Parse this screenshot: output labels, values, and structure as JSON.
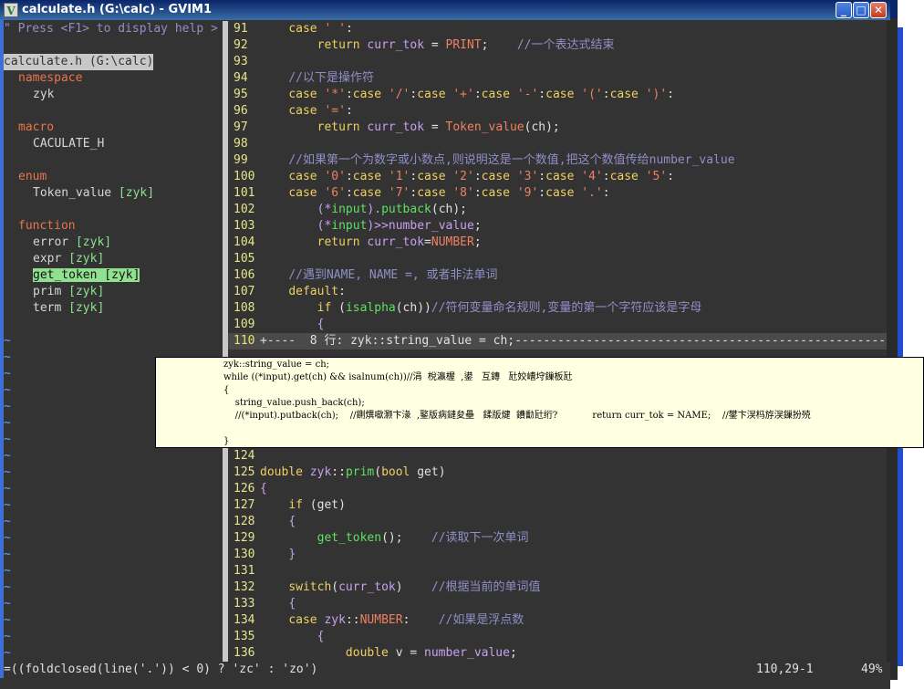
{
  "window": {
    "title": "calculate.h (G:\\calc) - GVIM1",
    "icon_letter": "V",
    "buttons": {
      "minimize": "_",
      "maximize": "□",
      "close": "✕"
    }
  },
  "taglist": {
    "help_hint": "\" Press <F1> to display help >",
    "file": "calculate.h (G:\\calc)",
    "groups": [
      {
        "kind": "namespace",
        "items": [
          {
            "name": "zyk",
            "scope": ""
          }
        ]
      },
      {
        "kind": "macro",
        "items": [
          {
            "name": "CACULATE_H",
            "scope": ""
          }
        ]
      },
      {
        "kind": "enum",
        "items": [
          {
            "name": "Token_value",
            "scope": "[zyk]"
          }
        ]
      },
      {
        "kind": "function",
        "items": [
          {
            "name": "error",
            "scope": "[zyk]"
          },
          {
            "name": "expr",
            "scope": "[zyk]"
          },
          {
            "name": "get_token",
            "scope": "[zyk]",
            "selected": true
          },
          {
            "name": "prim",
            "scope": "[zyk]"
          },
          {
            "name": "term",
            "scope": "[zyk]"
          }
        ]
      }
    ],
    "tilde": "~"
  },
  "code_lines": [
    {
      "n": "91",
      "segs": [
        [
          "tx",
          "    "
        ],
        [
          "kw",
          "case"
        ],
        [
          "tx",
          " "
        ],
        [
          "str",
          "' '"
        ],
        [
          "tx",
          ":"
        ]
      ]
    },
    {
      "n": "92",
      "segs": [
        [
          "tx",
          "        "
        ],
        [
          "kw",
          "return"
        ],
        [
          "tx",
          " "
        ],
        [
          "id",
          "curr_tok"
        ],
        [
          "tx",
          " = "
        ],
        [
          "str",
          "PRINT"
        ],
        [
          "tx",
          ";    "
        ],
        [
          "cm",
          "//一个表达式结束"
        ]
      ]
    },
    {
      "n": "93",
      "segs": []
    },
    {
      "n": "94",
      "segs": [
        [
          "tx",
          "    "
        ],
        [
          "cm",
          "//以下是操作符"
        ]
      ]
    },
    {
      "n": "95",
      "segs": [
        [
          "tx",
          "    "
        ],
        [
          "kw",
          "case"
        ],
        [
          "tx",
          " "
        ],
        [
          "str",
          "'*'"
        ],
        [
          "tx",
          ":"
        ],
        [
          "kw",
          "case"
        ],
        [
          "tx",
          " "
        ],
        [
          "str",
          "'/'"
        ],
        [
          "tx",
          ":"
        ],
        [
          "kw",
          "case"
        ],
        [
          "tx",
          " "
        ],
        [
          "str",
          "'+'"
        ],
        [
          "tx",
          ":"
        ],
        [
          "kw",
          "case"
        ],
        [
          "tx",
          " "
        ],
        [
          "str",
          "'-'"
        ],
        [
          "tx",
          ":"
        ],
        [
          "kw",
          "case"
        ],
        [
          "tx",
          " "
        ],
        [
          "str",
          "'('"
        ],
        [
          "tx",
          ":"
        ],
        [
          "kw",
          "case"
        ],
        [
          "tx",
          " "
        ],
        [
          "str",
          "')'"
        ],
        [
          "tx",
          ":"
        ]
      ]
    },
    {
      "n": "96",
      "segs": [
        [
          "tx",
          "    "
        ],
        [
          "kw",
          "case"
        ],
        [
          "tx",
          " "
        ],
        [
          "str",
          "'='"
        ],
        [
          "tx",
          ":"
        ]
      ]
    },
    {
      "n": "97",
      "segs": [
        [
          "tx",
          "        "
        ],
        [
          "kw",
          "return"
        ],
        [
          "tx",
          " "
        ],
        [
          "id",
          "curr_tok"
        ],
        [
          "tx",
          " = "
        ],
        [
          "str",
          "Token_value"
        ],
        [
          "tx",
          "(ch);"
        ]
      ]
    },
    {
      "n": "98",
      "segs": []
    },
    {
      "n": "99",
      "segs": [
        [
          "tx",
          "    "
        ],
        [
          "cm",
          "//如果第一个为数字或小数点,则说明这是一个数值,把这个数值传给number_value"
        ]
      ]
    },
    {
      "n": "100",
      "segs": [
        [
          "tx",
          "    "
        ],
        [
          "kw",
          "case"
        ],
        [
          "tx",
          " "
        ],
        [
          "str",
          "'0'"
        ],
        [
          "tx",
          ":"
        ],
        [
          "kw",
          "case"
        ],
        [
          "tx",
          " "
        ],
        [
          "str",
          "'1'"
        ],
        [
          "tx",
          ":"
        ],
        [
          "kw",
          "case"
        ],
        [
          "tx",
          " "
        ],
        [
          "str",
          "'2'"
        ],
        [
          "tx",
          ":"
        ],
        [
          "kw",
          "case"
        ],
        [
          "tx",
          " "
        ],
        [
          "str",
          "'3'"
        ],
        [
          "tx",
          ":"
        ],
        [
          "kw",
          "case"
        ],
        [
          "tx",
          " "
        ],
        [
          "str",
          "'4'"
        ],
        [
          "tx",
          ":"
        ],
        [
          "kw",
          "case"
        ],
        [
          "tx",
          " "
        ],
        [
          "str",
          "'5'"
        ],
        [
          "tx",
          ":"
        ]
      ]
    },
    {
      "n": "101",
      "segs": [
        [
          "tx",
          "    "
        ],
        [
          "kw",
          "case"
        ],
        [
          "tx",
          " "
        ],
        [
          "str",
          "'6'"
        ],
        [
          "tx",
          ":"
        ],
        [
          "kw",
          "case"
        ],
        [
          "tx",
          " "
        ],
        [
          "str",
          "'7'"
        ],
        [
          "tx",
          ":"
        ],
        [
          "kw",
          "case"
        ],
        [
          "tx",
          " "
        ],
        [
          "str",
          "'8'"
        ],
        [
          "tx",
          ":"
        ],
        [
          "kw",
          "case"
        ],
        [
          "tx",
          " "
        ],
        [
          "str",
          "'9'"
        ],
        [
          "tx",
          ":"
        ],
        [
          "kw",
          "case"
        ],
        [
          "tx",
          " "
        ],
        [
          "str",
          "'.'"
        ],
        [
          "tx",
          ":"
        ]
      ]
    },
    {
      "n": "102",
      "segs": [
        [
          "tx",
          "        "
        ],
        [
          "id",
          "(*"
        ],
        [
          "fn",
          "input"
        ],
        [
          "id",
          ")."
        ],
        [
          "fn",
          "putback"
        ],
        [
          "tx",
          "(ch);"
        ]
      ]
    },
    {
      "n": "103",
      "segs": [
        [
          "tx",
          "        "
        ],
        [
          "id",
          "(*"
        ],
        [
          "fn",
          "input"
        ],
        [
          "id",
          ")>>"
        ],
        [
          "id",
          "number_value"
        ],
        [
          "tx",
          ";"
        ]
      ]
    },
    {
      "n": "104",
      "segs": [
        [
          "tx",
          "        "
        ],
        [
          "kw",
          "return"
        ],
        [
          "tx",
          " "
        ],
        [
          "id",
          "curr_tok"
        ],
        [
          "tx",
          "="
        ],
        [
          "str",
          "NUMBER"
        ],
        [
          "tx",
          ";"
        ]
      ]
    },
    {
      "n": "105",
      "segs": []
    },
    {
      "n": "106",
      "segs": [
        [
          "tx",
          "    "
        ],
        [
          "cm",
          "//遇到NAME, NAME =, 或者非法单词"
        ]
      ]
    },
    {
      "n": "107",
      "segs": [
        [
          "tx",
          "    "
        ],
        [
          "kw",
          "default"
        ],
        [
          "tx",
          ":"
        ]
      ]
    },
    {
      "n": "108",
      "segs": [
        [
          "tx",
          "        "
        ],
        [
          "kw",
          "if"
        ],
        [
          "tx",
          " ("
        ],
        [
          "fn",
          "isalpha"
        ],
        [
          "tx",
          "(ch))"
        ],
        [
          "cm",
          "//符何变量命名规则,变量的第一个字符应该是字母"
        ]
      ]
    },
    {
      "n": "109",
      "segs": [
        [
          "tx",
          "        "
        ],
        [
          "id",
          "{"
        ]
      ]
    },
    {
      "n": "110",
      "fold": true,
      "segs": [
        [
          "tx",
          "+----  8 行: zyk::string_value = ch;-----------------------------------------------------"
        ]
      ]
    },
    {
      "n": "",
      "segs": [],
      "hidden": true
    },
    {
      "n": "",
      "segs": [],
      "hidden": true
    },
    {
      "n": "",
      "segs": [],
      "hidden": true
    },
    {
      "n": "",
      "segs": [],
      "hidden": true
    },
    {
      "n": "",
      "segs": [],
      "hidden": true
    },
    {
      "n": "",
      "segs": [],
      "hidden": true
    },
    {
      "n": "124",
      "segs": []
    },
    {
      "n": "125",
      "segs": [
        [
          "ty",
          "double"
        ],
        [
          "tx",
          " "
        ],
        [
          "id",
          "zyk"
        ],
        [
          "tx",
          "::"
        ],
        [
          "fn",
          "prim"
        ],
        [
          "tx",
          "("
        ],
        [
          "ty",
          "bool"
        ],
        [
          "tx",
          " get)"
        ]
      ]
    },
    {
      "n": "126",
      "segs": [
        [
          "id",
          "{"
        ]
      ]
    },
    {
      "n": "127",
      "segs": [
        [
          "tx",
          "    "
        ],
        [
          "kw",
          "if"
        ],
        [
          "tx",
          " (get)"
        ]
      ]
    },
    {
      "n": "128",
      "segs": [
        [
          "tx",
          "    "
        ],
        [
          "id",
          "{"
        ]
      ]
    },
    {
      "n": "129",
      "segs": [
        [
          "tx",
          "        "
        ],
        [
          "fn",
          "get_token"
        ],
        [
          "tx",
          "();    "
        ],
        [
          "cm",
          "//读取下一次单词"
        ]
      ]
    },
    {
      "n": "130",
      "segs": [
        [
          "tx",
          "    "
        ],
        [
          "id",
          "}"
        ]
      ]
    },
    {
      "n": "131",
      "segs": []
    },
    {
      "n": "132",
      "segs": [
        [
          "tx",
          "    "
        ],
        [
          "kw",
          "switch"
        ],
        [
          "tx",
          "("
        ],
        [
          "id",
          "curr_tok"
        ],
        [
          "tx",
          ")    "
        ],
        [
          "cm",
          "//根据当前的单词值"
        ]
      ]
    },
    {
      "n": "133",
      "segs": [
        [
          "tx",
          "    "
        ],
        [
          "id",
          "{"
        ]
      ]
    },
    {
      "n": "134",
      "segs": [
        [
          "tx",
          "    "
        ],
        [
          "kw",
          "case"
        ],
        [
          "tx",
          " "
        ],
        [
          "id",
          "zyk"
        ],
        [
          "tx",
          "::"
        ],
        [
          "str",
          "NUMBER"
        ],
        [
          "tx",
          ":    "
        ],
        [
          "cm",
          "//如果是浮点数"
        ]
      ]
    },
    {
      "n": "135",
      "segs": [
        [
          "tx",
          "        "
        ],
        [
          "id",
          "{"
        ]
      ]
    },
    {
      "n": "136",
      "segs": [
        [
          "tx",
          "            "
        ],
        [
          "ty",
          "double"
        ],
        [
          "tx",
          " v = "
        ],
        [
          "id",
          "number_value"
        ],
        [
          "tx",
          ";"
        ]
      ]
    }
  ],
  "balloon": {
    "lines": [
      "zyk::string_value = ch;",
      "while ((*input).get(ch) && isalnum(ch))//涓  梲瀛楃  ,鍙   互鏄   瓧姣嶆垨鏁板瓧",
      "{",
      "    string_value.push_back(ch);",
      "    //(*input).putback(ch);    //鍘熼噷灏卞湪  ,鐜版病鏈夋壘   鍒版煡  鐨勫瓧绗?            return curr_tok = NAME;    //鐢卞洖杩斿洖鏁扮殑",
      "",
      "}"
    ]
  },
  "cmdline": {
    "text": "=((foldclosed(line('.')) < 0) ? 'zc' : 'zo')",
    "position": "110,29-1",
    "percent": "49%"
  },
  "colors": {
    "background": "#333333",
    "keyword": "#f0d060",
    "string": "#f08060",
    "identifier": "#c8a0f0",
    "comment": "#8f8fc8",
    "function": "#60e060",
    "line_number": "#e6e68a",
    "selection": "#8fe08f",
    "balloon": "#ffffe1"
  }
}
